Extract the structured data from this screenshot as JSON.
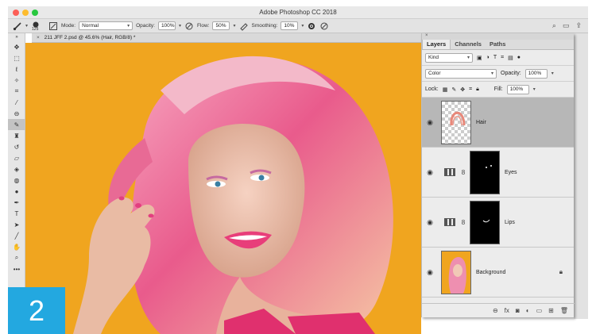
{
  "window": {
    "title": "Adobe Photoshop CC 2018"
  },
  "options_bar": {
    "brush_size": "125",
    "mode_label": "Mode:",
    "mode_value": "Normal",
    "opacity_label": "Opacity:",
    "opacity_value": "100%",
    "flow_label": "Flow:",
    "flow_value": "50%",
    "smoothing_label": "Smoothing:",
    "smoothing_value": "10%"
  },
  "document": {
    "tab_label": "211 JFF 2.psd @ 45.6% (Hair, RGB/8) *"
  },
  "badge": {
    "number": "2"
  },
  "colors": {
    "canvas_bg": "#f0a51f",
    "badge_bg": "#23a8e0",
    "selected_layer": "#b7b7b7"
  },
  "layers_panel": {
    "tabs": [
      "Layers",
      "Channels",
      "Paths"
    ],
    "filter_kind": "Kind",
    "blend_mode": "Color",
    "opacity_label": "Opacity:",
    "opacity_value": "100%",
    "lock_label": "Lock:",
    "fill_label": "Fill:",
    "fill_value": "100%",
    "layers": [
      {
        "name": "Hair",
        "selected": true,
        "visible": true
      },
      {
        "name": "Eyes",
        "selected": false,
        "visible": true
      },
      {
        "name": "Lips",
        "selected": false,
        "visible": true
      },
      {
        "name": "Background",
        "selected": false,
        "visible": true,
        "locked": true
      }
    ]
  }
}
